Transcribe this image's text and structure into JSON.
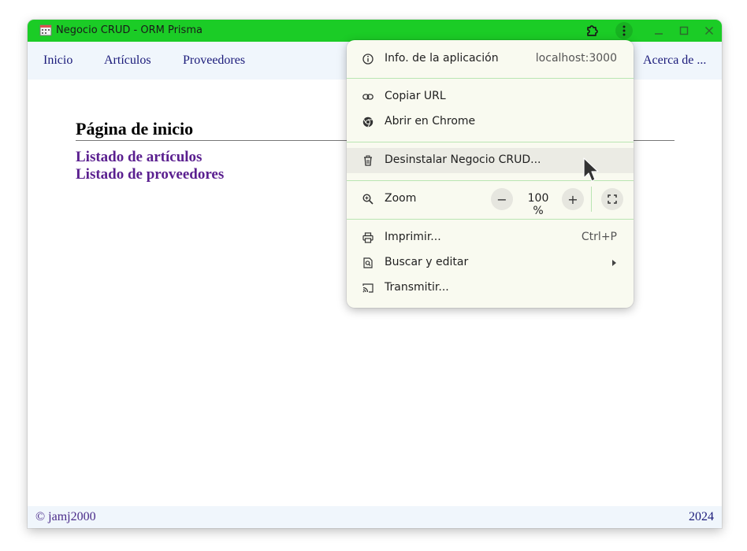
{
  "window": {
    "title": "Negocio CRUD - ORM Prisma"
  },
  "nav": {
    "items": [
      "Inicio",
      "Artículos",
      "Proveedores"
    ],
    "about": "Acerca de ..."
  },
  "main": {
    "heading": "Página de inicio",
    "links": [
      "Listado de artículos",
      "Listado de proveedores"
    ]
  },
  "footer": {
    "left": "© jamj2000",
    "right": "2024"
  },
  "menu": {
    "app_info_label": "Info. de la aplicación",
    "app_info_host": "localhost:3000",
    "copy_url": "Copiar URL",
    "open_in_chrome": "Abrir en Chrome",
    "uninstall": "Desinstalar Negocio CRUD...",
    "zoom_label": "Zoom",
    "zoom_minus": "−",
    "zoom_value": "100 %",
    "zoom_plus": "+",
    "print_label": "Imprimir...",
    "print_shortcut": "Ctrl+P",
    "find_edit": "Buscar y editar",
    "cast": "Transmitir..."
  },
  "colors": {
    "titlebar": "#1bcc26",
    "nav_background": "#f0f6fc",
    "link_visited": "#5a1f8f",
    "link": "#1a1a7a",
    "menu_background": "#f9faf0",
    "menu_separator": "#b9e5b2"
  },
  "icons": {
    "app": "calendar-app-icon",
    "extensions": "puzzle-icon",
    "menu": "vertical-dots-icon",
    "minimize": "minimize-icon",
    "maximize": "maximize-icon",
    "close": "close-icon"
  }
}
